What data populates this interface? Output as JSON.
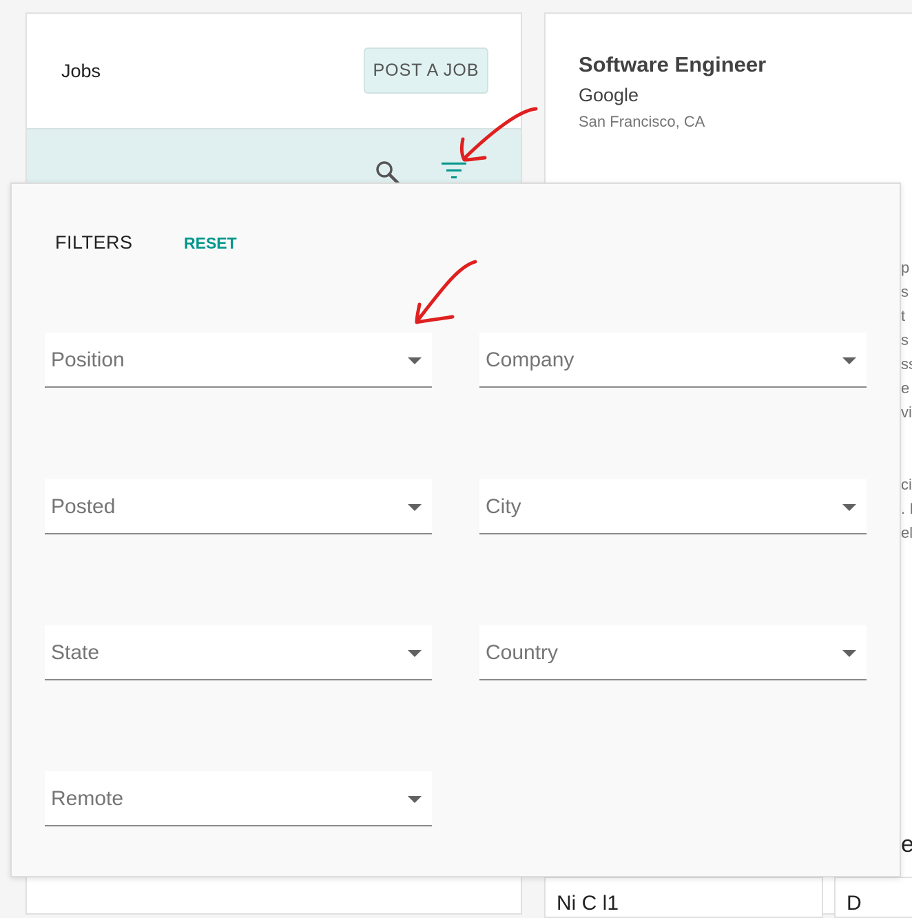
{
  "jobs_panel": {
    "title": "Jobs",
    "post_job_label": "POST A JOB",
    "search_icon": "search-icon",
    "filter_icon": "filter-list-icon"
  },
  "job_detail": {
    "title": "Software Engineer",
    "company": "Google",
    "location": "San Francisco, CA"
  },
  "filters": {
    "title": "FILTERS",
    "reset_label": "RESET",
    "fields": [
      {
        "label": "Position"
      },
      {
        "label": "Company"
      },
      {
        "label": "Posted"
      },
      {
        "label": "City"
      },
      {
        "label": "State"
      },
      {
        "label": "Country"
      },
      {
        "label": "Remote"
      }
    ]
  },
  "background_fragments": [
    "p",
    "s",
    "t",
    "s (",
    "ss",
    "e ip",
    "vit",
    "ci",
    ". I",
    "el"
  ],
  "bottom_cards": [
    "Ni  C  l1",
    "D"
  ],
  "side_card_fragment": "e",
  "colors": {
    "accent": "#00968a",
    "annotation": "#e02020",
    "toolbar_bg": "#e0f0f0"
  }
}
